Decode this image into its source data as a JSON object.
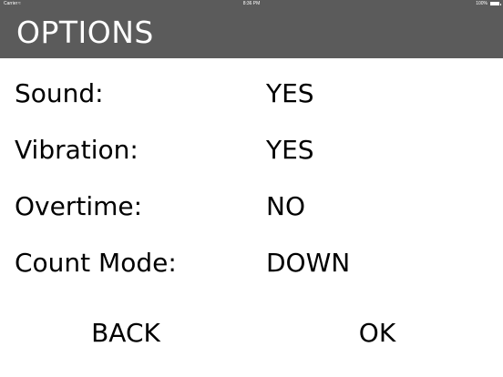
{
  "status_bar": {
    "carrier": "Carrier",
    "wifi_icon": "wifi-icon",
    "time": "8:36 PM",
    "battery_percent": "100%",
    "battery_level": 1.0
  },
  "header": {
    "title": "OPTIONS",
    "background_color": "#5b5b5b"
  },
  "options": [
    {
      "label": "Sound:",
      "value": "YES"
    },
    {
      "label": "Vibration:",
      "value": "YES"
    },
    {
      "label": "Overtime:",
      "value": "NO"
    },
    {
      "label": "Count Mode:",
      "value": "DOWN"
    }
  ],
  "buttons": {
    "back_label": "BACK",
    "ok_label": "OK"
  }
}
